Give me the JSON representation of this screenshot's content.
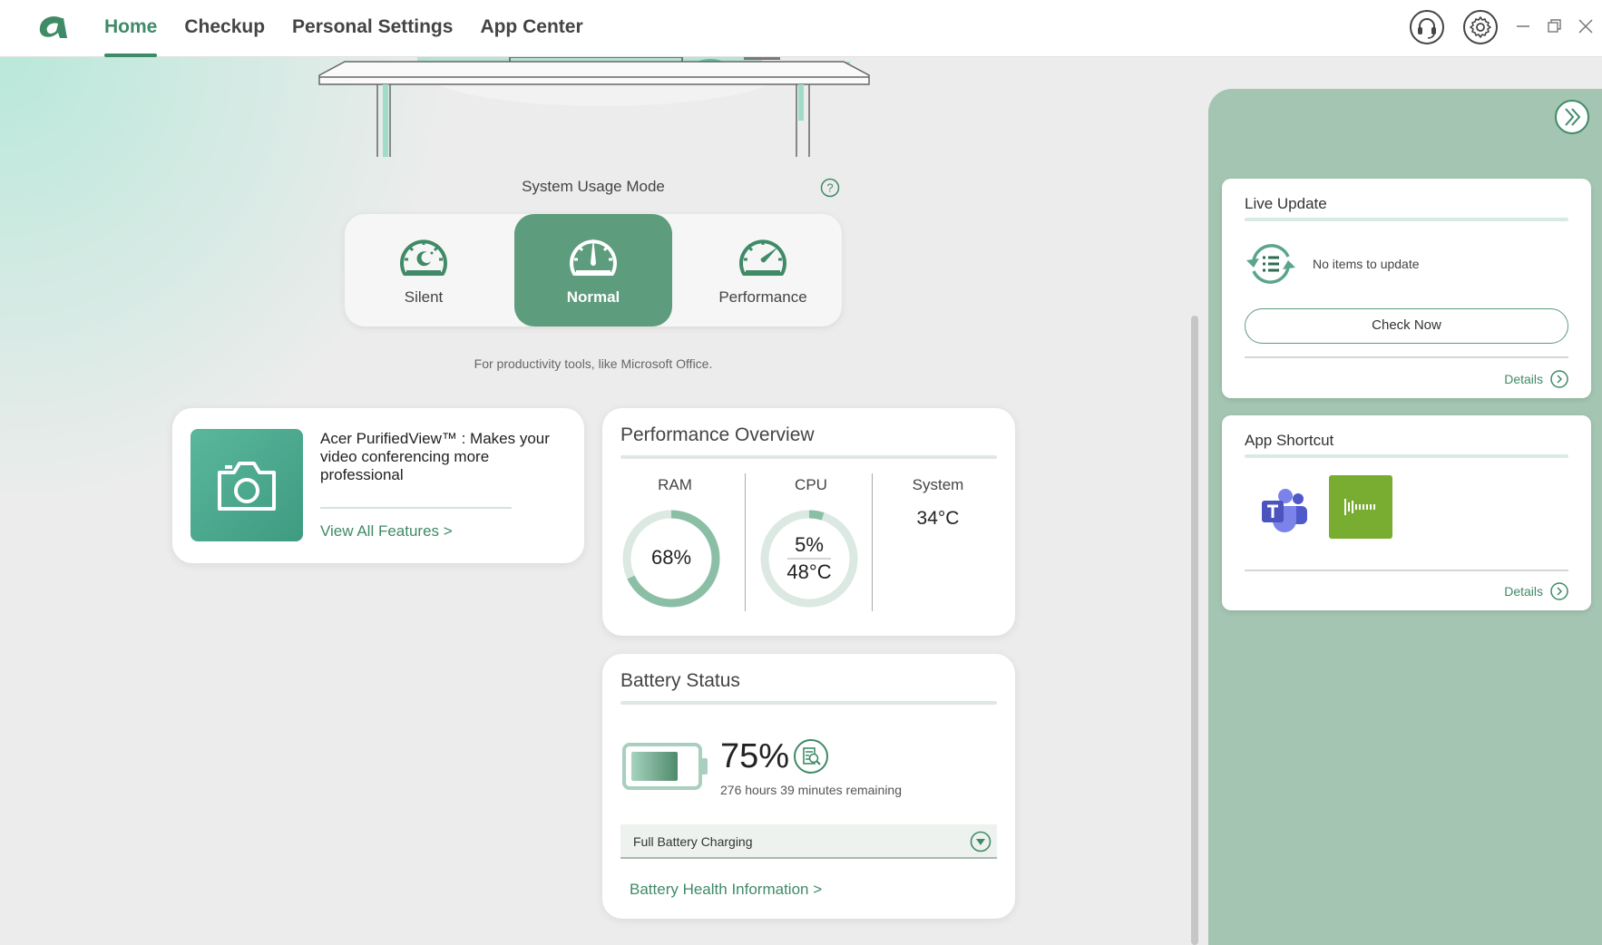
{
  "nav": {
    "items": [
      {
        "label": "Home",
        "active": true
      },
      {
        "label": "Checkup",
        "active": false
      },
      {
        "label": "Personal Settings",
        "active": false
      },
      {
        "label": "App Center",
        "active": false
      }
    ]
  },
  "icons": {
    "logo": "acer-a-logo",
    "support": "headset-icon",
    "settings": "gear-icon",
    "minimize": "minimize-icon",
    "restore": "restore-icon",
    "close": "close-icon"
  },
  "usage_mode": {
    "title": "System Usage Mode",
    "modes": [
      {
        "label": "Silent",
        "icon": "speedometer-moon-icon",
        "active": false
      },
      {
        "label": "Normal",
        "icon": "speedometer-mid-icon",
        "active": true
      },
      {
        "label": "Performance",
        "icon": "speedometer-high-icon",
        "active": false
      }
    ],
    "description": "For productivity tools, like Microsoft Office."
  },
  "purified": {
    "text": "Acer PurifiedView™ : Makes your video conferencing more professional",
    "link": "View All Features >"
  },
  "performance": {
    "title": "Performance Overview",
    "ram": {
      "label": "RAM",
      "value": "68%",
      "percent": 68
    },
    "cpu": {
      "label": "CPU",
      "value": "5%",
      "temp": "48°C",
      "percent": 5
    },
    "system": {
      "label": "System",
      "temp": "34°C"
    }
  },
  "battery": {
    "title": "Battery Status",
    "percent": "75%",
    "fill": 75,
    "remaining": "276 hours 39 minutes remaining",
    "mode": "Full Battery Charging",
    "link": "Battery Health Information >"
  },
  "live_update": {
    "title": "Live Update",
    "message": "No items to update",
    "button": "Check Now",
    "details": "Details"
  },
  "app_shortcut": {
    "title": "App Shortcut",
    "apps": [
      "microsoft-teams-icon",
      "voice-app-icon"
    ],
    "details": "Details"
  },
  "colors": {
    "accent": "#3f8a67",
    "mode_active": "#5d9c7c",
    "panel": "#a3c5b1"
  }
}
